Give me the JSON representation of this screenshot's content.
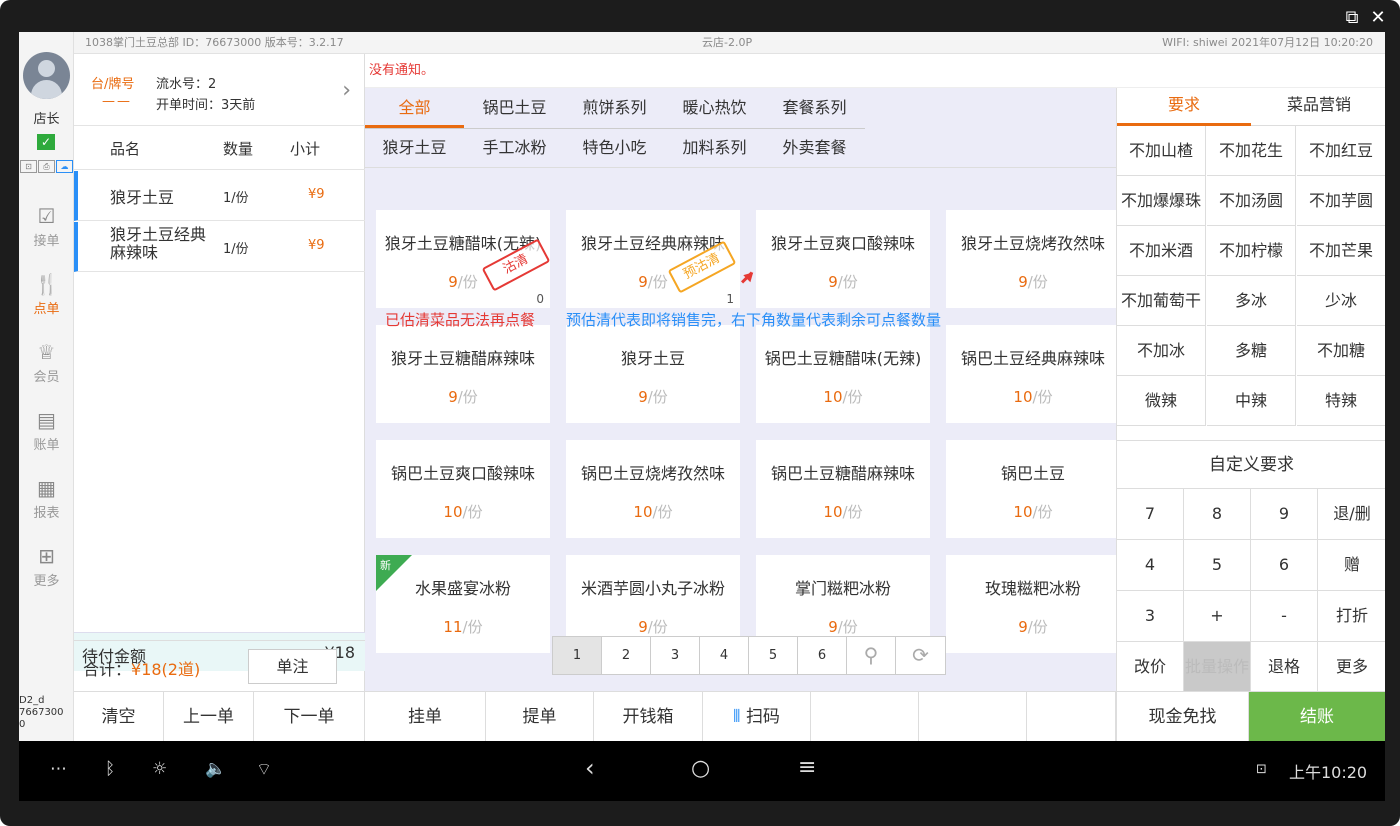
{
  "window": {
    "popout_icon": "popout-icon",
    "close_icon": "close-icon"
  },
  "status": {
    "store": "1038掌门土豆总部 ID：76673000   版本号：3.2.17",
    "app": "云店-2.0P",
    "wifi_time": "WIFI: shiwei   2021年07月12日 10:20:20"
  },
  "nav": {
    "role": "店长",
    "device_id": "D2_d\n7667300\n0",
    "items": [
      {
        "label": "接单",
        "icon": "inbox-icon"
      },
      {
        "label": "点单",
        "icon": "order-icon"
      },
      {
        "label": "会员",
        "icon": "crown-icon"
      },
      {
        "label": "账单",
        "icon": "bill-icon"
      },
      {
        "label": "报表",
        "icon": "report-icon"
      },
      {
        "label": "更多",
        "icon": "grid-icon"
      }
    ]
  },
  "ticket": {
    "table_label": "台/牌号",
    "table_value": "——",
    "serial": "流水号：2",
    "open_time": "开单时间：3天前",
    "headers": {
      "name": "品名",
      "qty": "数量",
      "subtotal": "小计"
    },
    "rows": [
      {
        "name": "狼牙土豆",
        "qty": "1/份",
        "price": "¥9"
      },
      {
        "name": "狼牙土豆经典\n麻辣味",
        "qty": "1/份",
        "price": "¥9"
      }
    ],
    "pending_label": "待付金额",
    "pending_value": "¥18",
    "total_label": "合计：",
    "total_value": "¥18(2道)",
    "note_button": "单注"
  },
  "notice": "没有通知。",
  "categories": {
    "row1": [
      "全部",
      "锅巴土豆",
      "煎饼系列",
      "暖心热饮",
      "套餐系列"
    ],
    "row2": [
      "狼牙土豆",
      "手工冰粉",
      "特色小吃",
      "加料系列",
      "外卖套餐"
    ]
  },
  "dishes": [
    {
      "name": "狼牙土豆糖醋味(无辣)",
      "price": "9",
      "unit": "/份",
      "count": "0",
      "stamp": "沽清"
    },
    {
      "name": "狼牙土豆经典麻辣味",
      "price": "9",
      "unit": "/份",
      "count": "1",
      "stamp": "预沽清"
    },
    {
      "name": "狼牙土豆爽口酸辣味",
      "price": "9",
      "unit": "/份"
    },
    {
      "name": "狼牙土豆烧烤孜然味",
      "price": "9",
      "unit": "/份"
    },
    {
      "name": "狼牙土豆糖醋麻辣味",
      "price": "9",
      "unit": "/份"
    },
    {
      "name": "狼牙土豆",
      "price": "9",
      "unit": "/份"
    },
    {
      "name": "锅巴土豆糖醋味(无辣)",
      "price": "10",
      "unit": "/份"
    },
    {
      "name": "锅巴土豆经典麻辣味",
      "price": "10",
      "unit": "/份"
    },
    {
      "name": "锅巴土豆爽口酸辣味",
      "price": "10",
      "unit": "/份"
    },
    {
      "name": "锅巴土豆烧烤孜然味",
      "price": "10",
      "unit": "/份"
    },
    {
      "name": "锅巴土豆糖醋麻辣味",
      "price": "10",
      "unit": "/份"
    },
    {
      "name": "锅巴土豆",
      "price": "10",
      "unit": "/份"
    },
    {
      "name": "水果盛宴冰粉",
      "price": "11",
      "unit": "/份",
      "tag": "新"
    },
    {
      "name": "米酒芋圆小丸子冰粉",
      "price": "9",
      "unit": "/份"
    },
    {
      "name": "掌门糍粑冰粉",
      "price": "9",
      "unit": "/份"
    },
    {
      "name": "玫瑰糍粑冰粉",
      "price": "9",
      "unit": "/份"
    }
  ],
  "annotations": {
    "sold_out_note": "已估清菜品无法再点餐",
    "pre_sold_out_note": "预估清代表即将销售完，右下角数量代表剩余可点餐数量"
  },
  "pager": {
    "pages": [
      "1",
      "2",
      "3",
      "4",
      "5",
      "6"
    ],
    "search_icon": "search-icon",
    "refresh_icon": "refresh-icon"
  },
  "right": {
    "tabs": [
      "要求",
      "菜品营销"
    ],
    "requirements": [
      "不加山楂",
      "不加花生",
      "不加红豆",
      "不加爆爆珠",
      "不加汤圆",
      "不加芋圆",
      "不加米酒",
      "不加柠檬",
      "不加芒果",
      "不加葡萄干",
      "多冰",
      "少冰",
      "不加冰",
      "多糖",
      "不加糖",
      "微辣",
      "中辣",
      "特辣"
    ],
    "custom": "自定义要求",
    "keypad": [
      "7",
      "8",
      "9",
      "退/删",
      "4",
      "5",
      "6",
      "赠",
      "3",
      "+",
      "-",
      "打折",
      "改价",
      "批量操作",
      "退格",
      "更多"
    ]
  },
  "bottom": {
    "left": [
      "清空",
      "上一单",
      "下一单"
    ],
    "mid": [
      "挂单",
      "提单",
      "开钱箱",
      "扫码"
    ],
    "cash": "现金免找",
    "checkout": "结账"
  },
  "sysbar": {
    "time": "上午10:20"
  }
}
